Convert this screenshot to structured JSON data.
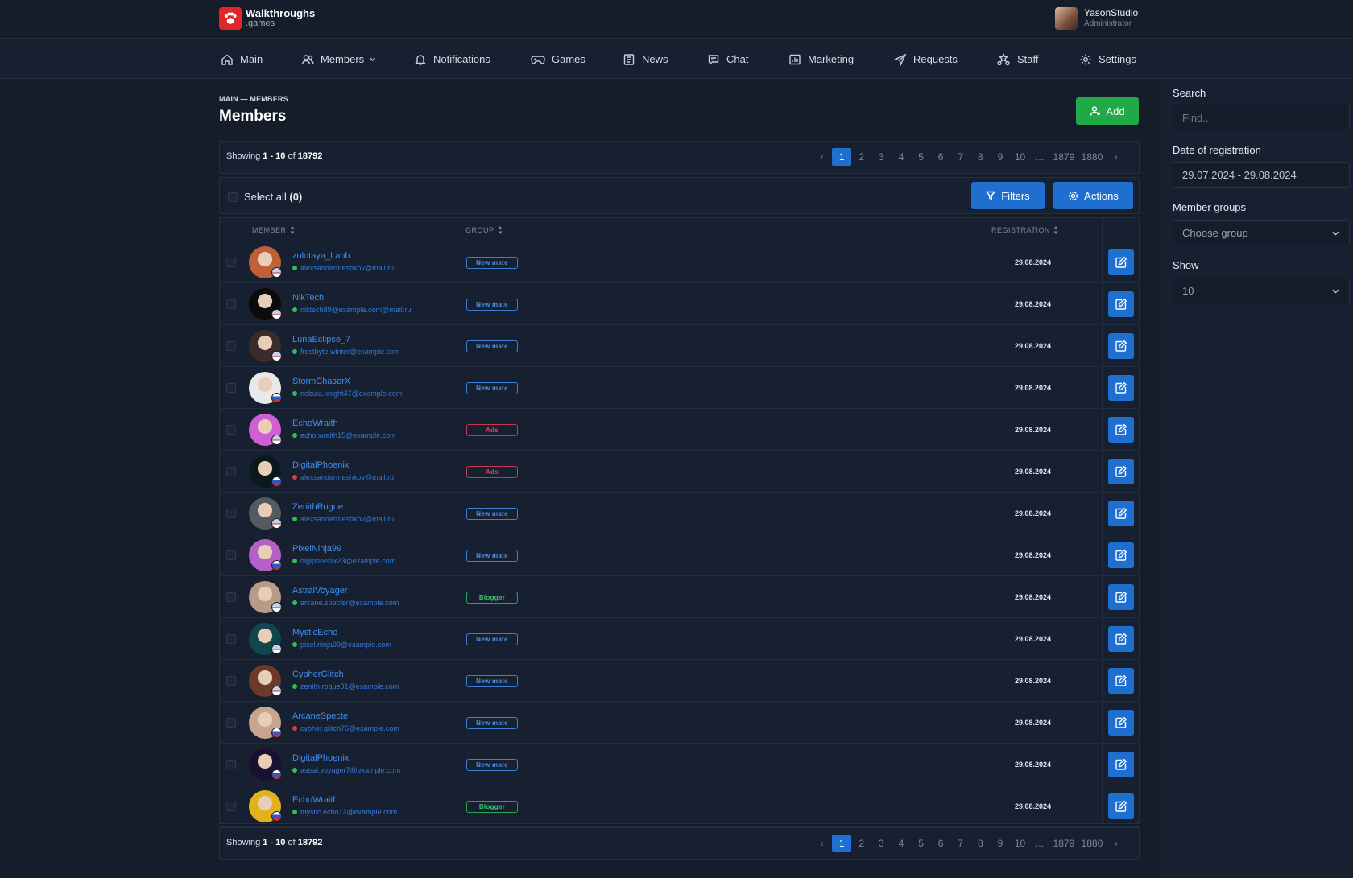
{
  "brand": {
    "title": "Walkthroughs",
    "subtitle": ".games",
    "color": "#e0262b"
  },
  "user": {
    "name": "YasonStudio",
    "role": "Administrator"
  },
  "nav": {
    "main": "Main",
    "members": "Members",
    "notifications": "Notifications",
    "games": "Games",
    "news": "News",
    "chat": "Chat",
    "marketing": "Marketing",
    "requests": "Requests",
    "staff": "Staff",
    "settings": "Settings"
  },
  "breadcrumb": "MAIN — MEMBERS",
  "page_title": "Members",
  "add_label": "Add",
  "pagination": {
    "showing_prefix": "Showing",
    "range": "1 - 10",
    "of_label": "of",
    "total": "18792",
    "pages": [
      "1",
      "2",
      "3",
      "4",
      "5",
      "6",
      "7",
      "8",
      "9",
      "10"
    ],
    "ellipsis": "...",
    "last_pages": [
      "1879",
      "1880"
    ],
    "prev": "‹",
    "next": "›"
  },
  "select_all": {
    "label": "Select all",
    "count": "(0)"
  },
  "filters_label": "Filters",
  "actions_label": "Actions",
  "table": {
    "headers": {
      "member": "MEMBER",
      "group": "GROUP",
      "registration": "REGISTRATION"
    },
    "rows": [
      {
        "name": "zolotaya_Lanb",
        "email": "alexsandermeshkov@mail.ru",
        "status": "online",
        "group": "New mate",
        "group_type": "newmate",
        "date": "29.08.2024",
        "flag": "us",
        "avatar": "#c0603a"
      },
      {
        "name": "NikTech",
        "email": "niktech89@example.com@mail.ru",
        "status": "online",
        "group": "New mate",
        "group_type": "newmate",
        "date": "29.08.2024",
        "flag": "us",
        "avatar": "#0b0b0b"
      },
      {
        "name": "LunaEclipse_7",
        "email": "frostbyte.winter@example.com",
        "status": "online",
        "group": "New mate",
        "group_type": "newmate",
        "date": "29.08.2024",
        "flag": "us",
        "avatar": "#3a2c28"
      },
      {
        "name": "StormChaserX",
        "email": "nebula.knight47@example.com",
        "status": "online",
        "group": "New mate",
        "group_type": "newmate",
        "date": "29.08.2024",
        "flag": "ru",
        "avatar": "#e9e9e9"
      },
      {
        "name": "EchoWraith",
        "email": "echo.wraith15@example.com",
        "status": "online",
        "group": "Ads",
        "group_type": "ads",
        "date": "29.08.2024",
        "flag": "us",
        "avatar": "#d05fd6"
      },
      {
        "name": "DigitalPhoenix",
        "email": "alexsandermeshkov@mail.ru",
        "status": "offline",
        "group": "Ads",
        "group_type": "ads",
        "date": "29.08.2024",
        "flag": "ru",
        "avatar": "#0a1a1c"
      },
      {
        "name": "ZenithRogue",
        "email": "alexsandermeshkov@mail.ru",
        "status": "online",
        "group": "New mate",
        "group_type": "newmate",
        "date": "29.08.2024",
        "flag": "us",
        "avatar": "#555a60"
      },
      {
        "name": "PixelNinja99",
        "email": "digiphoenix23@example.com",
        "status": "online",
        "group": "New mate",
        "group_type": "newmate",
        "date": "29.08.2024",
        "flag": "ru",
        "avatar": "#b55fc8"
      },
      {
        "name": "AstralVoyager",
        "email": "arcane.specter@example.com",
        "status": "online",
        "group": "Blogger",
        "group_type": "blogger",
        "date": "29.08.2024",
        "flag": "us",
        "avatar": "#b89a88"
      },
      {
        "name": "MysticEcho",
        "email": "pixel.ninja99@example.com",
        "status": "online",
        "group": "New mate",
        "group_type": "newmate",
        "date": "29.08.2024",
        "flag": "us",
        "avatar": "#12464f"
      },
      {
        "name": "CypherGlitch",
        "email": "zenith.rogue01@example.com",
        "status": "online",
        "group": "New mate",
        "group_type": "newmate",
        "date": "29.08.2024",
        "flag": "us",
        "avatar": "#6b3b28"
      },
      {
        "name": "ArcaneSpecte",
        "email": "cypher.glitch76@example.com",
        "status": "offline",
        "group": "New mate",
        "group_type": "newmate",
        "date": "29.08.2024",
        "flag": "ru",
        "avatar": "#c9a48e"
      },
      {
        "name": "DigitalPhoenix",
        "email": "astral.voyager7@example.com",
        "status": "online",
        "group": "New mate",
        "group_type": "newmate",
        "date": "29.08.2024",
        "flag": "ru",
        "avatar": "#1a1030"
      },
      {
        "name": "EchoWraith",
        "email": "mystic.echo12@example.com",
        "status": "online",
        "group": "Blogger",
        "group_type": "blogger",
        "date": "29.08.2024",
        "flag": "ru",
        "avatar": "#e2b21c"
      }
    ]
  },
  "sidebar": {
    "search_label": "Search",
    "search_placeholder": "Find...",
    "date_label": "Date of registration",
    "date_value": "29.07.2024 - 29.08.2024",
    "groups_label": "Member groups",
    "groups_value": "Choose group",
    "show_label": "Show",
    "show_value": "10"
  },
  "colors": {
    "accent": "#1f6fd0",
    "success": "#22a947",
    "link": "#3f8ef0",
    "background": "#151d2b"
  }
}
